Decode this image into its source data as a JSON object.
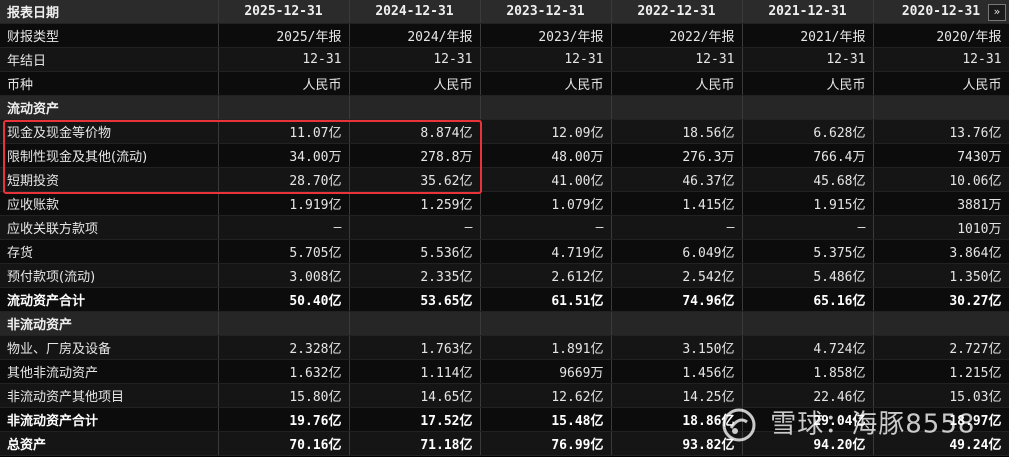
{
  "header": {
    "label": "报表日期",
    "dates": [
      "2025-12-31",
      "2024-12-31",
      "2023-12-31",
      "2022-12-31",
      "2021-12-31",
      "2020-12-31"
    ],
    "nav_icon": "double-chevron-right-icon"
  },
  "rows": [
    {
      "label": "财报类型",
      "values": [
        "2025/年报",
        "2024/年报",
        "2023/年报",
        "2022/年报",
        "2021/年报",
        "2020/年报"
      ]
    },
    {
      "label": "年结日",
      "values": [
        "12-31",
        "12-31",
        "12-31",
        "12-31",
        "12-31",
        "12-31"
      ]
    },
    {
      "label": "币种",
      "values": [
        "人民币",
        "人民币",
        "人民币",
        "人民币",
        "人民币",
        "人民币"
      ]
    },
    {
      "label": "流动资产",
      "section": true
    },
    {
      "label": "现金及现金等价物",
      "values": [
        "11.07亿",
        "8.874亿",
        "12.09亿",
        "18.56亿",
        "6.628亿",
        "13.76亿"
      ]
    },
    {
      "label": "限制性现金及其他(流动)",
      "values": [
        "34.00万",
        "278.8万",
        "48.00万",
        "276.3万",
        "766.4万",
        "7430万"
      ]
    },
    {
      "label": "短期投资",
      "values": [
        "28.70亿",
        "35.62亿",
        "41.00亿",
        "46.37亿",
        "45.68亿",
        "10.06亿"
      ]
    },
    {
      "label": "应收账款",
      "values": [
        "1.919亿",
        "1.259亿",
        "1.079亿",
        "1.415亿",
        "1.915亿",
        "3881万"
      ]
    },
    {
      "label": "应收关联方款项",
      "values": [
        "—",
        "—",
        "—",
        "—",
        "—",
        "1010万"
      ]
    },
    {
      "label": "存货",
      "values": [
        "5.705亿",
        "5.536亿",
        "4.719亿",
        "6.049亿",
        "5.375亿",
        "3.864亿"
      ]
    },
    {
      "label": "预付款项(流动)",
      "values": [
        "3.008亿",
        "2.335亿",
        "2.612亿",
        "2.542亿",
        "5.486亿",
        "1.350亿"
      ]
    },
    {
      "label": "流动资产合计",
      "total": true,
      "values": [
        "50.40亿",
        "53.65亿",
        "61.51亿",
        "74.96亿",
        "65.16亿",
        "30.27亿"
      ]
    },
    {
      "label": "非流动资产",
      "section": true
    },
    {
      "label": "物业、厂房及设备",
      "values": [
        "2.328亿",
        "1.763亿",
        "1.891亿",
        "3.150亿",
        "4.724亿",
        "2.727亿"
      ]
    },
    {
      "label": "其他非流动资产",
      "values": [
        "1.632亿",
        "1.114亿",
        "9669万",
        "1.456亿",
        "1.858亿",
        "1.215亿"
      ]
    },
    {
      "label": "非流动资产其他项目",
      "values": [
        "15.80亿",
        "14.65亿",
        "12.62亿",
        "14.25亿",
        "22.46亿",
        "15.03亿"
      ]
    },
    {
      "label": "非流动资产合计",
      "total": true,
      "values": [
        "19.76亿",
        "17.52亿",
        "15.48亿",
        "18.86亿",
        "29.04亿",
        "18.97亿"
      ]
    },
    {
      "label": "总资产",
      "total": true,
      "values": [
        "70.16亿",
        "71.18亿",
        "76.99亿",
        "93.82亿",
        "94.20亿",
        "49.24亿"
      ]
    }
  ],
  "watermark": {
    "text": "雪球：海豚8558",
    "icon": "snowball-logo-icon"
  },
  "highlight_color": "#e8333a"
}
